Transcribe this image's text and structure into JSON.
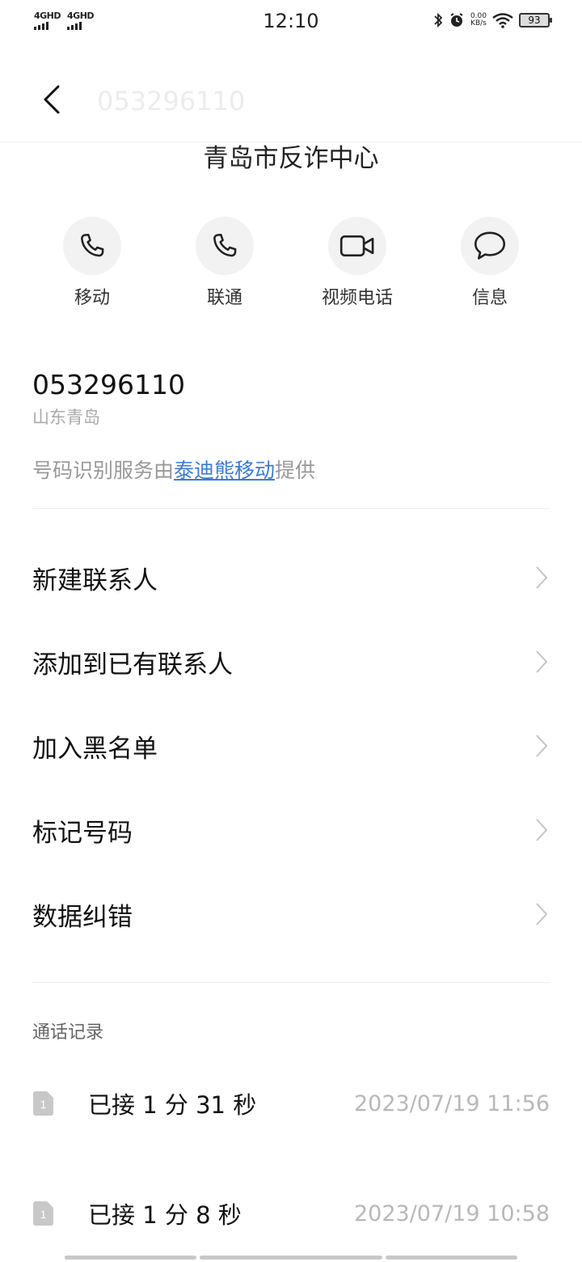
{
  "status_bar": {
    "signal1": "4GHD",
    "signal2": "4GHD",
    "time": "12:10",
    "net_speed_value": "0.00",
    "net_speed_unit": "KB/s",
    "battery": "93"
  },
  "header": {
    "title": "053296110"
  },
  "contact": {
    "name": "青岛市反诈中心"
  },
  "actions": [
    {
      "label": "移动",
      "icon": "phone-icon"
    },
    {
      "label": "联通",
      "icon": "phone-icon"
    },
    {
      "label": "视频电话",
      "icon": "video-call-icon"
    },
    {
      "label": "信息",
      "icon": "message-icon"
    }
  ],
  "number_info": {
    "number": "053296110",
    "location": "山东青岛",
    "provider_prefix": "号码识别服务由",
    "provider_link": "泰迪熊移动",
    "provider_suffix": "提供"
  },
  "menu": [
    {
      "label": "新建联系人"
    },
    {
      "label": "添加到已有联系人"
    },
    {
      "label": "加入黑名单"
    },
    {
      "label": "标记号码"
    },
    {
      "label": "数据纠错"
    }
  ],
  "call_log": {
    "title": "通话记录",
    "entries": [
      {
        "sim": "1",
        "desc": "已接 1 分 31 秒",
        "time": "2023/07/19 11:56"
      },
      {
        "sim": "1",
        "desc": "已接 1 分 8 秒",
        "time": "2023/07/19 10:58"
      }
    ]
  },
  "colors": {
    "link": "#3a7bd5",
    "action_bg": "#f2f2f2"
  }
}
